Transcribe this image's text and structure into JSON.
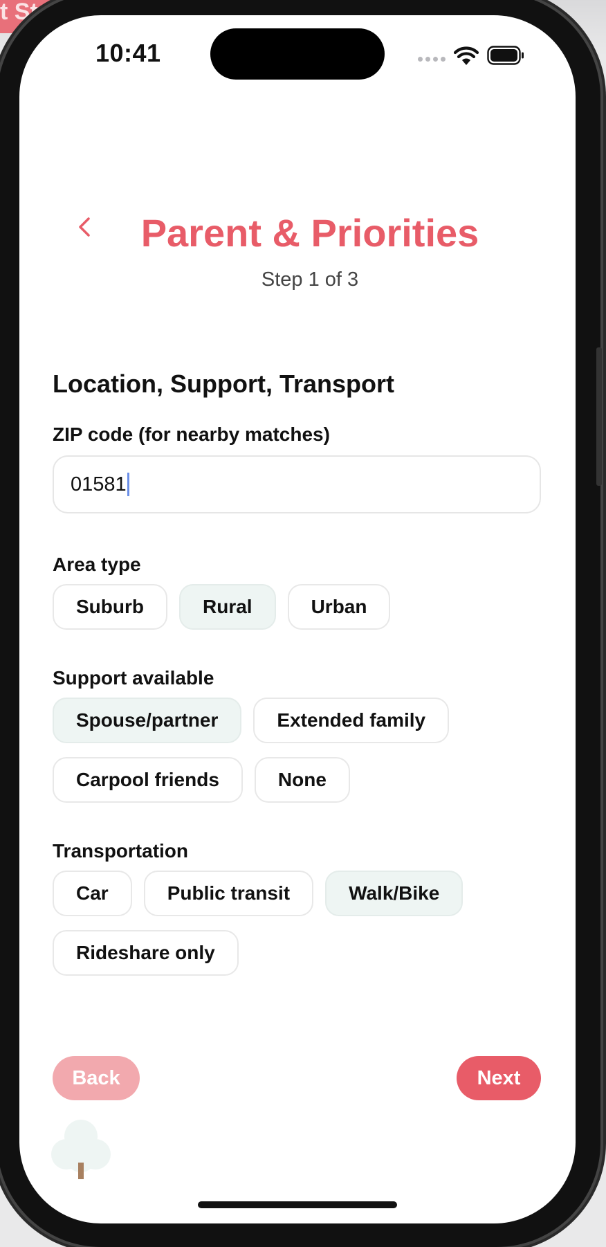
{
  "background_app": {
    "partial_button_label": "t Start"
  },
  "status_bar": {
    "time": "10:41",
    "wifi_icon": "wifi-icon",
    "battery_icon": "battery-icon"
  },
  "header": {
    "back_icon": "chevron-left-icon",
    "title": "Parent & Priorities",
    "step": "Step 1 of 3"
  },
  "section": {
    "title": "Location, Support, Transport"
  },
  "zip": {
    "label": "ZIP code (for nearby matches)",
    "value": "01581"
  },
  "area_type": {
    "label": "Area type",
    "options": [
      {
        "label": "Suburb",
        "selected": false
      },
      {
        "label": "Rural",
        "selected": true
      },
      {
        "label": "Urban",
        "selected": false
      }
    ]
  },
  "support": {
    "label": "Support available",
    "options": [
      {
        "label": "Spouse/partner",
        "selected": true
      },
      {
        "label": "Extended family",
        "selected": false
      },
      {
        "label": "Carpool friends",
        "selected": false
      },
      {
        "label": "None",
        "selected": false
      }
    ]
  },
  "transportation": {
    "label": "Transportation",
    "options": [
      {
        "label": "Car",
        "selected": false
      },
      {
        "label": "Public transit",
        "selected": false
      },
      {
        "label": "Walk/Bike",
        "selected": true
      },
      {
        "label": "Rideshare only",
        "selected": false
      }
    ]
  },
  "footer": {
    "back_label": "Back",
    "next_label": "Next",
    "decoration_icon": "tree-icon"
  },
  "colors": {
    "accent": "#e85c68",
    "accent_disabled": "#f2a9ae",
    "chip_selected_bg": "#eef5f3"
  }
}
